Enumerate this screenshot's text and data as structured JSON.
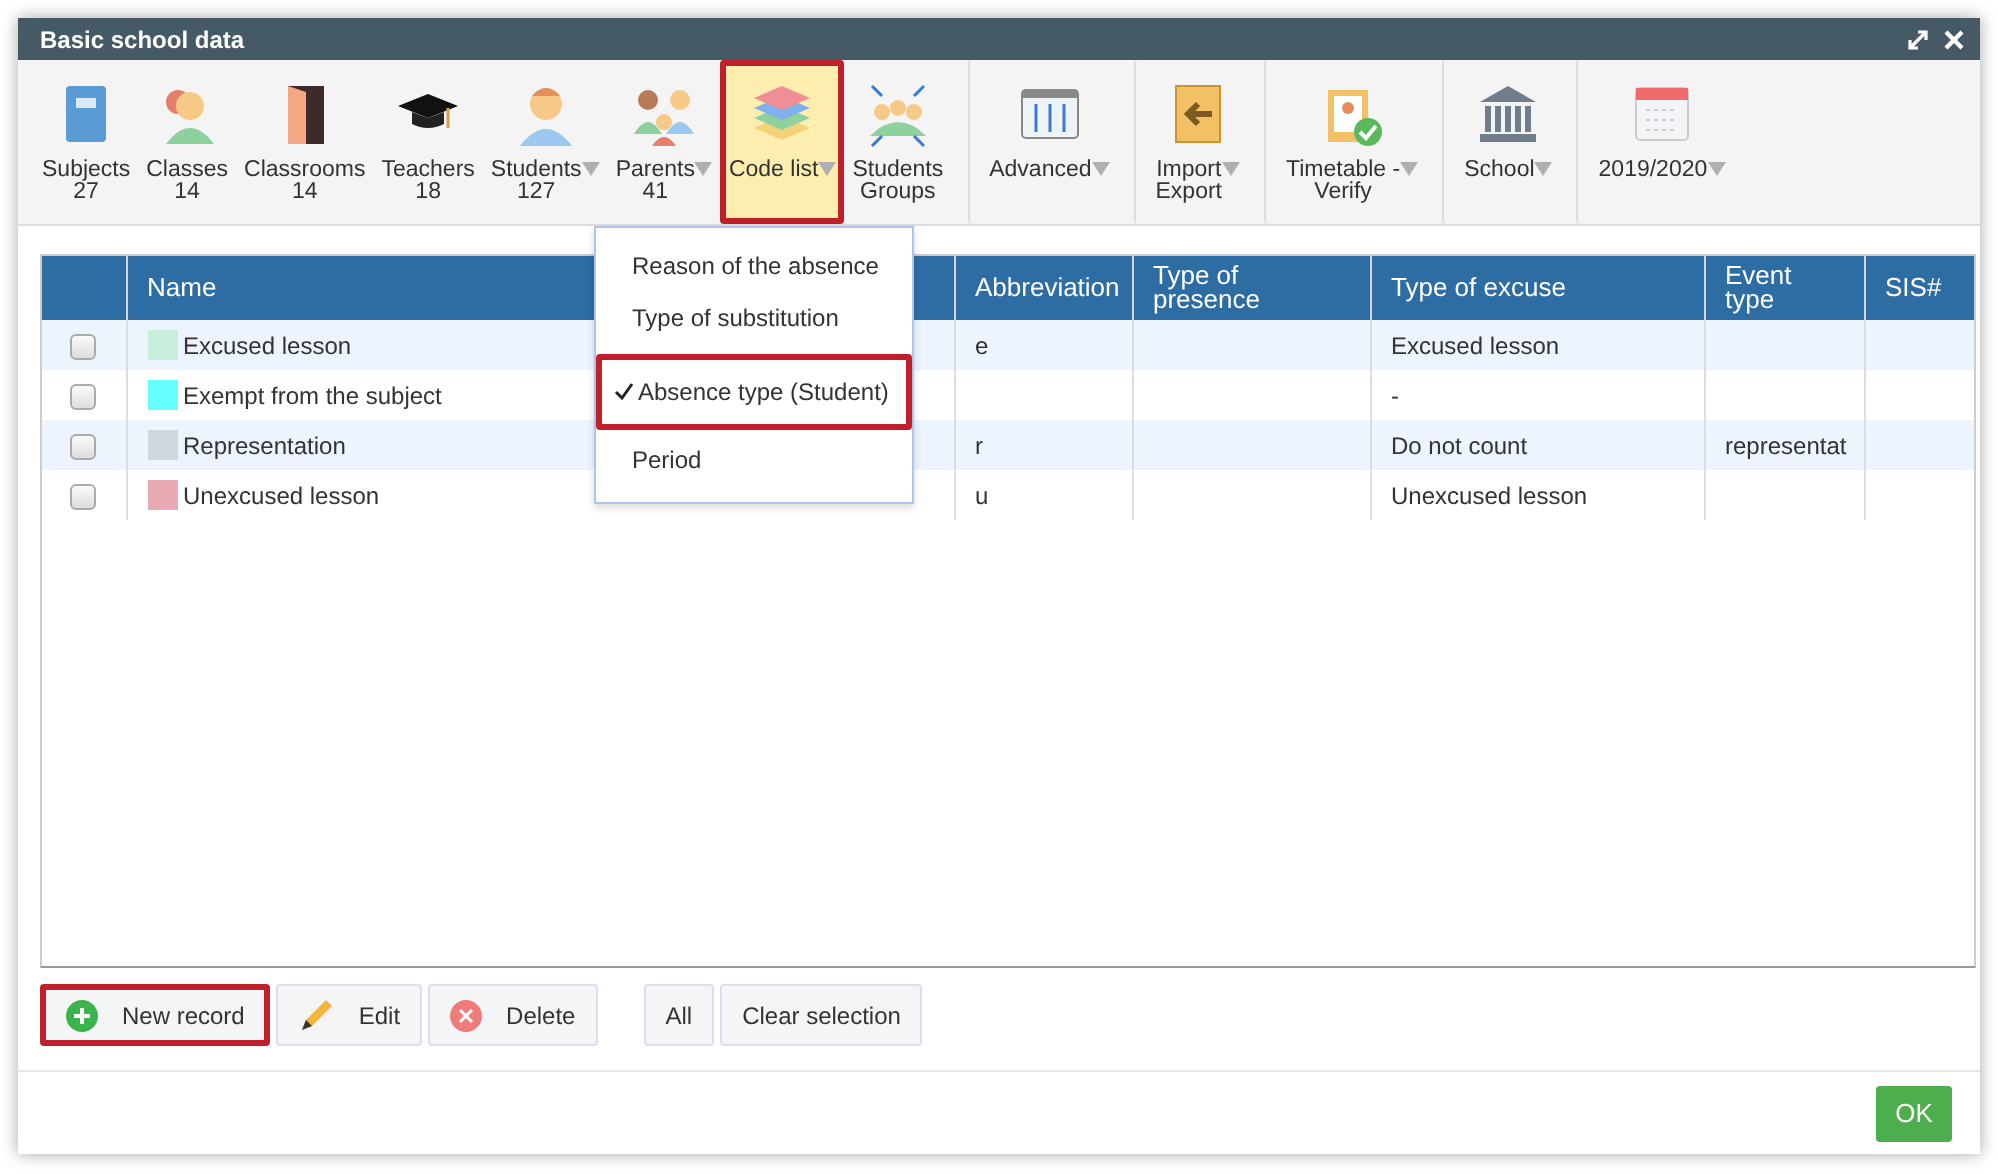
{
  "window": {
    "title": "Basic school data"
  },
  "toolbar": [
    {
      "lines": [
        "Subjects",
        "27"
      ],
      "dropdown": false,
      "selected": false,
      "highlighted": false,
      "separated": false
    },
    {
      "lines": [
        "Classes",
        "14"
      ],
      "dropdown": false,
      "selected": false,
      "highlighted": false,
      "separated": false
    },
    {
      "lines": [
        "Classrooms",
        "14"
      ],
      "dropdown": false,
      "selected": false,
      "highlighted": false,
      "separated": false
    },
    {
      "lines": [
        "Teachers",
        "18"
      ],
      "dropdown": false,
      "selected": false,
      "highlighted": false,
      "separated": false
    },
    {
      "lines": [
        "Students",
        "127"
      ],
      "dropdown": true,
      "selected": false,
      "highlighted": false,
      "separated": false
    },
    {
      "lines": [
        "Parents",
        "41"
      ],
      "dropdown": true,
      "selected": false,
      "highlighted": false,
      "separated": false
    },
    {
      "lines": [
        "Code list"
      ],
      "dropdown": true,
      "selected": true,
      "highlighted": true,
      "separated": false
    },
    {
      "lines": [
        "Students",
        "Groups"
      ],
      "dropdown": false,
      "selected": false,
      "highlighted": false,
      "separated": false
    },
    {
      "lines": [
        "Advanced"
      ],
      "dropdown": true,
      "selected": false,
      "highlighted": false,
      "separated": true
    },
    {
      "lines": [
        "Import",
        "Export"
      ],
      "dropdown": true,
      "selected": false,
      "highlighted": false,
      "separated": true
    },
    {
      "lines": [
        "Timetable -",
        "Verify"
      ],
      "dropdown": true,
      "selected": false,
      "highlighted": false,
      "separated": true
    },
    {
      "lines": [
        "School"
      ],
      "dropdown": true,
      "selected": false,
      "highlighted": false,
      "separated": true
    },
    {
      "lines": [
        "2019/2020"
      ],
      "dropdown": true,
      "selected": false,
      "highlighted": false,
      "separated": true
    }
  ],
  "menu": [
    {
      "label": "Reason of the absence",
      "checked": false,
      "highlighted": false
    },
    {
      "label": "Type of substitution",
      "checked": false,
      "highlighted": false
    },
    {
      "label": "Absence type (Student)",
      "checked": true,
      "highlighted": true
    },
    {
      "label": "Period",
      "checked": false,
      "highlighted": false
    }
  ],
  "table": {
    "columns": [
      "Name",
      "Abbreviation",
      "Type of presence",
      "Type of excuse",
      "Event type",
      "SIS#"
    ],
    "rows": [
      {
        "checked": false,
        "color": "#c8eedb",
        "name": "Excused lesson",
        "abbreviation": "e",
        "excuse": "Excused lesson"
      },
      {
        "checked": false,
        "color": "#66ffff",
        "name": "Exempt from the subject",
        "excuse": "-"
      },
      {
        "checked": false,
        "color": "#cfd8dc",
        "name": "Representation",
        "abbreviation": "r",
        "excuse": "Do not count",
        "event_type": "representat"
      },
      {
        "checked": false,
        "color": "#e8a9b2",
        "name": "Unexcused lesson",
        "abbreviation": "u",
        "excuse": "Unexcused lesson"
      }
    ]
  },
  "buttons": [
    {
      "kind": "add",
      "label": "New record",
      "highlighted": true
    },
    {
      "kind": "edit",
      "label": "Edit",
      "highlighted": false
    },
    {
      "kind": "delete",
      "label": "Delete",
      "highlighted": false
    }
  ],
  "selection_buttons": [
    "All",
    "Clear selection"
  ],
  "ok_button": "OK"
}
